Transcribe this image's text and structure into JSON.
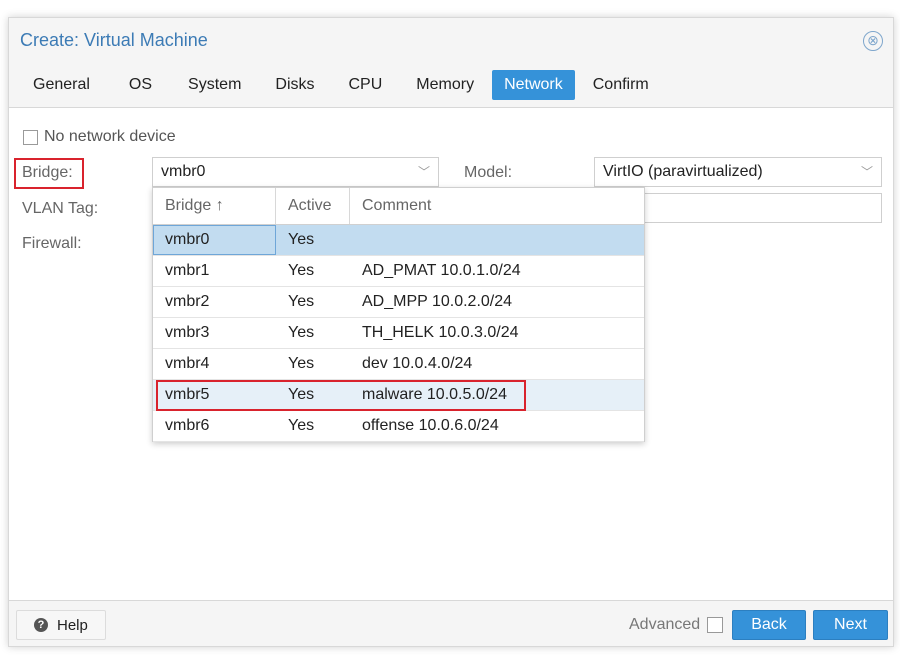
{
  "window": {
    "title": "Create: Virtual Machine",
    "close_icon": "⊗"
  },
  "tabs": [
    {
      "label": "General",
      "active": false
    },
    {
      "label": "OS",
      "active": false
    },
    {
      "label": "System",
      "active": false
    },
    {
      "label": "Disks",
      "active": false
    },
    {
      "label": "CPU",
      "active": false
    },
    {
      "label": "Memory",
      "active": false
    },
    {
      "label": "Network",
      "active": true
    },
    {
      "label": "Confirm",
      "active": false
    }
  ],
  "form": {
    "no_network_device": {
      "label": "No network device",
      "checked": false
    },
    "bridge": {
      "label": "Bridge:",
      "value": "vmbr0"
    },
    "vlan_tag": {
      "label": "VLAN Tag:",
      "value": ""
    },
    "firewall": {
      "label": "Firewall:"
    },
    "model": {
      "label": "Model:",
      "value": "VirtIO (paravirtualized)"
    },
    "chevron_icon": "﹀"
  },
  "bridge_dropdown": {
    "columns": [
      "Bridge ↑",
      "Active",
      "Comment"
    ],
    "rows": [
      {
        "bridge": "vmbr0",
        "active": "Yes",
        "comment": "",
        "state": "selected"
      },
      {
        "bridge": "vmbr1",
        "active": "Yes",
        "comment": "AD_PMAT 10.0.1.0/24",
        "state": ""
      },
      {
        "bridge": "vmbr2",
        "active": "Yes",
        "comment": "AD_MPP 10.0.2.0/24",
        "state": ""
      },
      {
        "bridge": "vmbr3",
        "active": "Yes",
        "comment": "TH_HELK 10.0.3.0/24",
        "state": ""
      },
      {
        "bridge": "vmbr4",
        "active": "Yes",
        "comment": "dev 10.0.4.0/24",
        "state": ""
      },
      {
        "bridge": "vmbr5",
        "active": "Yes",
        "comment": "malware 10.0.5.0/24",
        "state": "hovered"
      },
      {
        "bridge": "vmbr6",
        "active": "Yes",
        "comment": "offense 10.0.6.0/24",
        "state": ""
      }
    ]
  },
  "footer": {
    "help_label": "Help",
    "help_icon": "?",
    "advanced_label": "Advanced",
    "advanced_checked": false,
    "back_label": "Back",
    "next_label": "Next"
  },
  "colors": {
    "accent": "#3592d9",
    "title": "#3c7bb5",
    "highlight_border": "#d9232d",
    "selected_row": "#c2dcf0"
  }
}
